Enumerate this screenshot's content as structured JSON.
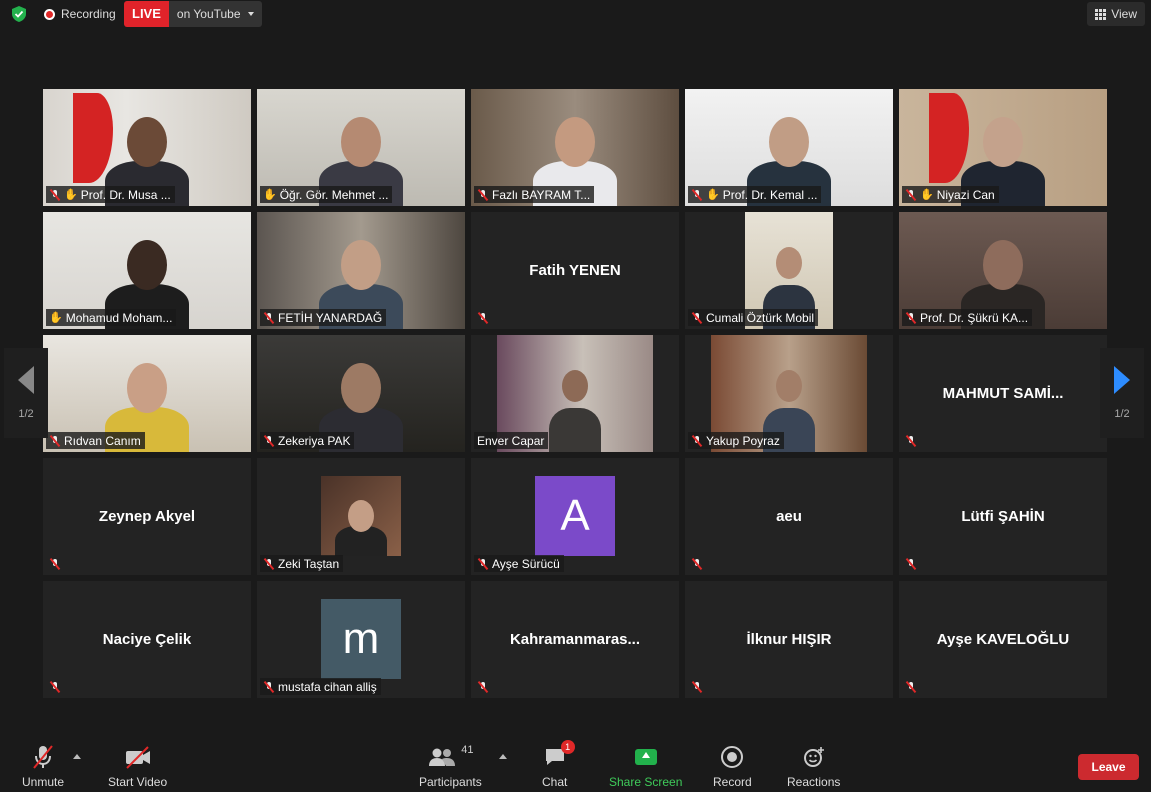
{
  "topbar": {
    "recording_label": "Recording",
    "live_badge": "LIVE",
    "live_destination": "on YouTube",
    "view_label": "View"
  },
  "colors": {
    "active_speaker_border": "#e6e35c",
    "live_red": "#e0232a",
    "share_green": "#22b14c",
    "leave_red": "#cc2a2f",
    "avatar_purple": "#7b4ac9",
    "avatar_slate": "#445a66"
  },
  "grid": {
    "page_left": "1/2",
    "page_right": "1/2",
    "tiles": [
      {
        "label": "Prof. Dr. Musa ...",
        "center_name": "",
        "kind": "video",
        "pinned": true,
        "muted": true,
        "active": false,
        "scene": "flag-office"
      },
      {
        "label": "Öğr. Gör. Mehmet ...",
        "center_name": "",
        "kind": "video",
        "pinned": true,
        "muted": false,
        "active": true,
        "scene": "plain-room"
      },
      {
        "label": "Fazlı BAYRAM T...",
        "center_name": "",
        "kind": "video",
        "pinned": false,
        "muted": true,
        "active": false,
        "scene": "bookshelf"
      },
      {
        "label": "Prof. Dr. Kemal ...",
        "center_name": "",
        "kind": "video",
        "pinned": true,
        "muted": true,
        "active": false,
        "scene": "chair"
      },
      {
        "label": "Niyazi Can",
        "center_name": "",
        "kind": "video",
        "pinned": true,
        "muted": true,
        "active": false,
        "scene": "brick-flag"
      },
      {
        "label": "Mohamud Moham...",
        "center_name": "",
        "kind": "video",
        "pinned": true,
        "muted": false,
        "active": false,
        "scene": "white-wall"
      },
      {
        "label": "FETİH YANARDAĞ",
        "center_name": "",
        "kind": "video",
        "pinned": false,
        "muted": true,
        "active": false,
        "scene": "bookshelf2"
      },
      {
        "label": "",
        "center_name": "Fatih YENEN",
        "kind": "name",
        "pinned": false,
        "muted": true,
        "active": false,
        "scene": ""
      },
      {
        "label": "Cumali Öztürk Mobil",
        "center_name": "",
        "kind": "video",
        "pinned": false,
        "muted": true,
        "active": false,
        "scene": "portrait-room"
      },
      {
        "label": "Prof. Dr. Şükrü KA...",
        "center_name": "",
        "kind": "video",
        "pinned": false,
        "muted": true,
        "active": false,
        "scene": "dark-room"
      },
      {
        "label": "Rıdvan Canım",
        "center_name": "",
        "kind": "video",
        "pinned": false,
        "muted": true,
        "active": false,
        "scene": "sofa"
      },
      {
        "label": "Zekeriya PAK",
        "center_name": "",
        "kind": "video",
        "pinned": false,
        "muted": true,
        "active": false,
        "scene": "leather-chair"
      },
      {
        "label": "Enver Capar",
        "center_name": "",
        "kind": "video",
        "pinned": false,
        "muted": false,
        "active": false,
        "scene": "office-wall"
      },
      {
        "label": "Yakup Poyraz",
        "center_name": "",
        "kind": "video",
        "pinned": false,
        "muted": true,
        "active": false,
        "scene": "bookshelf3"
      },
      {
        "label": "",
        "center_name": "MAHMUT  SAMİ...",
        "kind": "name",
        "pinned": false,
        "muted": true,
        "active": false,
        "scene": ""
      },
      {
        "label": "",
        "center_name": "Zeynep Akyel",
        "kind": "name",
        "pinned": false,
        "muted": true,
        "active": false,
        "scene": ""
      },
      {
        "label": "Zeki Taştan",
        "center_name": "",
        "kind": "photo",
        "pinned": false,
        "muted": true,
        "active": false,
        "scene": "speaker-photo"
      },
      {
        "label": "Ayşe Sürücü",
        "center_name": "",
        "kind": "letter",
        "letter": "A",
        "letter_color": "#7b4ac9",
        "pinned": false,
        "muted": true,
        "active": false,
        "scene": ""
      },
      {
        "label": "",
        "center_name": "aeu",
        "kind": "name",
        "pinned": false,
        "muted": true,
        "active": false,
        "scene": ""
      },
      {
        "label": "",
        "center_name": "Lütfi ŞAHİN",
        "kind": "name",
        "pinned": false,
        "muted": true,
        "active": false,
        "scene": ""
      },
      {
        "label": "",
        "center_name": "Naciye Çelik",
        "kind": "name",
        "pinned": false,
        "muted": true,
        "active": false,
        "scene": ""
      },
      {
        "label": "mustafa cihan alliş",
        "center_name": "",
        "kind": "letter",
        "letter": "m",
        "letter_color": "#445a66",
        "pinned": false,
        "muted": true,
        "active": false,
        "scene": ""
      },
      {
        "label": "",
        "center_name": "Kahramanmaras...",
        "kind": "name",
        "pinned": false,
        "muted": true,
        "active": false,
        "scene": ""
      },
      {
        "label": "",
        "center_name": "İlknur HIŞIR",
        "kind": "name",
        "pinned": false,
        "muted": true,
        "active": false,
        "scene": ""
      },
      {
        "label": "",
        "center_name": "Ayşe KAVELOĞLU",
        "kind": "name",
        "pinned": false,
        "muted": true,
        "active": false,
        "scene": ""
      }
    ]
  },
  "toolbar": {
    "unmute": "Unmute",
    "start_video": "Start Video",
    "participants": "Participants",
    "participants_count": "41",
    "chat": "Chat",
    "chat_badge": "1",
    "share_screen": "Share Screen",
    "record": "Record",
    "reactions": "Reactions",
    "leave": "Leave"
  }
}
